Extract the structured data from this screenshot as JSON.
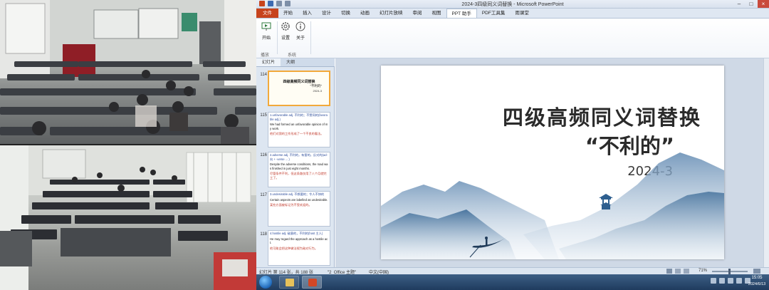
{
  "window": {
    "title": "2024-3四级同义词替换 - Microsoft PowerPoint"
  },
  "ribbon_tabs": [
    "文件",
    "开始",
    "插入",
    "设计",
    "切换",
    "动画",
    "幻灯片放映",
    "审阅",
    "视图",
    "PPT 助手",
    "PDF工具集",
    "雨课堂"
  ],
  "active_tab": "PPT 助手",
  "ribbon": {
    "buttons": [
      {
        "label": "开始",
        "icon": "presentation-icon"
      },
      {
        "label": "设置",
        "icon": "gear-icon"
      },
      {
        "label": "关于",
        "icon": "info-icon"
      }
    ],
    "groups": [
      "播放",
      "系统"
    ]
  },
  "pane": {
    "tabs": [
      "幻灯片",
      "大纲"
    ]
  },
  "thumbnails": [
    {
      "number": "114",
      "title": "四级高频同义词替换",
      "subtitle": "“不利的”",
      "year": "2024-3"
    },
    {
      "number": "115",
      "lines": [
        "1.unfavorable adj. 不利的；不赞同的(favorable adj.)",
        "We had formed an unfavorable opinion of my work.",
        "他们对我的工作形成了一个不良的看法。"
      ]
    },
    {
      "number": "116",
      "lines": [
        "2.adverse adj. 不利的，有害的，反对的(ad-向 + -verse ... )",
        "Despite the adverse conditions, the road was finished in just eight months.",
        "尽管条件不利，但这条路仅用了八个月就完工了。"
      ]
    },
    {
      "number": "117",
      "lines": [
        "3.undesirable adj. 不想要的；令人不快的",
        "Certain aspects are labelled as undesirable.",
        "某些方面被标记为不受欢迎的。"
      ]
    },
    {
      "number": "118",
      "lines": [
        "4.hostile adj. 敌意的，不利的(host 主人)",
        "He may regard the approach as a hostile act.",
        "他可能会把这种做法视为敌对行为。"
      ]
    }
  ],
  "slide": {
    "title": "四级高频同义词替换",
    "subtitle": "“不利的”",
    "date": "2024-3"
  },
  "status": {
    "slide_info": "幻灯片 第 114 张，共 188 张",
    "theme": "\"2_Office 主题\"",
    "language": "中文(中国)",
    "zoom": "71%"
  },
  "taskbar": {
    "time": "15:05",
    "date": "2024/6/13"
  },
  "colors": {
    "file_tab": "#c7431c",
    "thumb_selected_border": "#f2a93b",
    "mountain_blue": "#5f86ad"
  }
}
